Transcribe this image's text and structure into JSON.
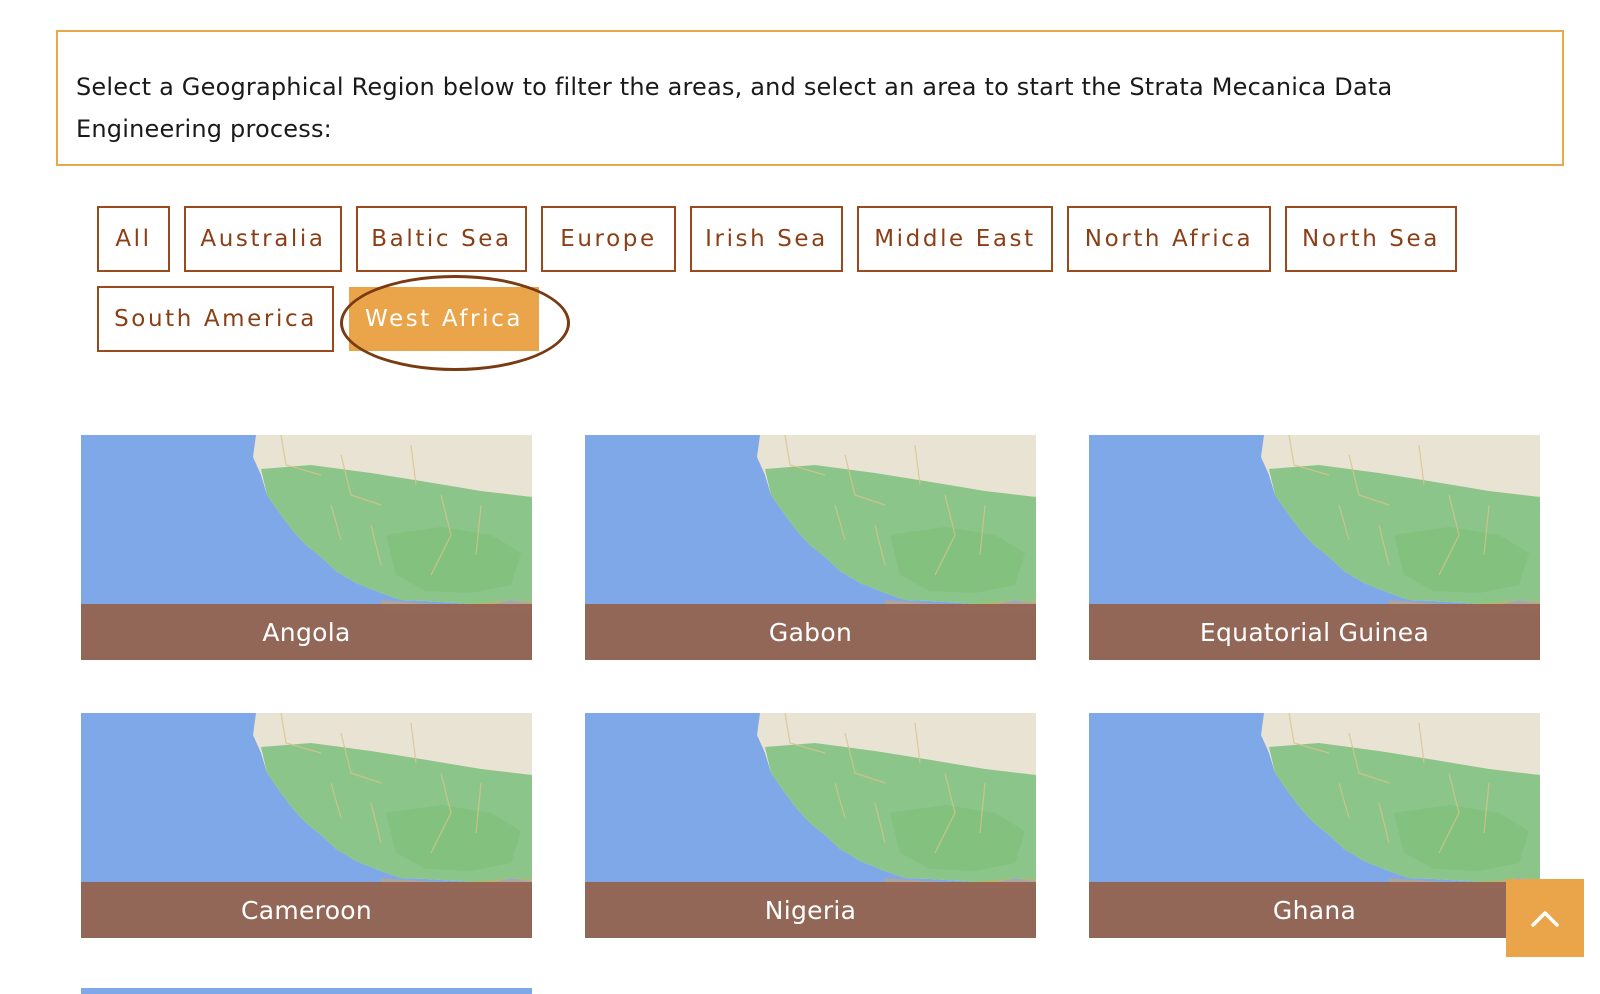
{
  "intro": {
    "text": "Select a Geographical Region below to filter the areas, and select an area to start the Strata Mecanica Data Engineering process:"
  },
  "filters": [
    {
      "label": "All",
      "active": false
    },
    {
      "label": "Australia",
      "active": false
    },
    {
      "label": "Baltic Sea",
      "active": false
    },
    {
      "label": "Europe",
      "active": false
    },
    {
      "label": "Irish Sea",
      "active": false
    },
    {
      "label": "Middle East",
      "active": false
    },
    {
      "label": "North Africa",
      "active": false
    },
    {
      "label": "North Sea",
      "active": false
    },
    {
      "label": "South America",
      "active": false
    },
    {
      "label": "West Africa",
      "active": true
    }
  ],
  "areas": [
    {
      "name": "Angola"
    },
    {
      "name": "Gabon"
    },
    {
      "name": "Equatorial Guinea"
    },
    {
      "name": "Cameroon"
    },
    {
      "name": "Nigeria"
    },
    {
      "name": "Ghana"
    }
  ],
  "colors": {
    "accent": "#eaa44a",
    "filter_border": "#9a4a1c",
    "caption_bg": "#946552",
    "ocean": "#7ea8e8",
    "land": "#8cc58a"
  },
  "icons": {
    "back_to_top": "chevron-up-icon"
  }
}
